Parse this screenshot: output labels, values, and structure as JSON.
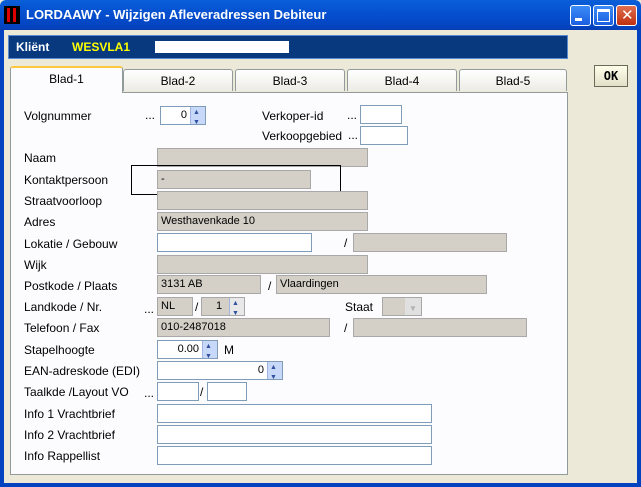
{
  "window": {
    "title": "LORDAAWY - Wijzigen Afleveradressen Debiteur"
  },
  "client": {
    "label": "Kliënt",
    "code": "WESVLA1",
    "name": ""
  },
  "tabs": [
    {
      "label": "Blad-1",
      "active": true
    },
    {
      "label": "Blad-2",
      "active": false
    },
    {
      "label": "Blad-3",
      "active": false
    },
    {
      "label": "Blad-4",
      "active": false
    },
    {
      "label": "Blad-5",
      "active": false
    }
  ],
  "ok_button": "OK",
  "form": {
    "volgnummer": {
      "label": "Volgnummer",
      "dots": "...",
      "value": "0"
    },
    "verkoper_id": {
      "label": "Verkoper-id",
      "dots": "...",
      "value": ""
    },
    "verkoopgebied": {
      "label": "Verkoopgebied",
      "dots": "...",
      "value": ""
    },
    "naam": {
      "label": "Naam",
      "value": ""
    },
    "kontaktpersoon": {
      "label": "Kontaktpersoon",
      "value": "-"
    },
    "straatvoorloop": {
      "label": "Straatvoorloop",
      "value": ""
    },
    "adres": {
      "label": "Adres",
      "value": "Westhavenkade 10"
    },
    "lokatie": {
      "label": "Lokatie / Gebouw",
      "value": "",
      "value2": "",
      "sep": "/"
    },
    "wijk": {
      "label": "Wijk",
      "value": ""
    },
    "postkode": {
      "label": "Postkode / Plaats",
      "postcode": "3131 AB",
      "plaats": "Vlaardingen",
      "sep": "/"
    },
    "landkode": {
      "label": "Landkode  / Nr.",
      "dots": "...",
      "land": "NL",
      "nr": "1",
      "sep": "/"
    },
    "staat": {
      "label": "Staat",
      "value": ""
    },
    "telefoon": {
      "label": "Telefoon / Fax",
      "telefoon": "010-2487018",
      "fax": "",
      "sep": "/"
    },
    "stapelhoogte": {
      "label": "Stapelhoogte",
      "value": "0.00",
      "unit": "M"
    },
    "ean": {
      "label": "EAN-adreskode (EDI)",
      "value": "0"
    },
    "taalkde": {
      "label": "Taalkde /Layout VO",
      "dots": "...",
      "value1": "",
      "value2": "",
      "sep": "/"
    },
    "info1": {
      "label": "Info 1 Vrachtbrief",
      "value": ""
    },
    "info2": {
      "label": "Info 2 Vrachtbrief",
      "value": ""
    },
    "info_rappel": {
      "label": "Info Rappellist",
      "value": ""
    }
  },
  "colors": {
    "titlebar": "#0551D0",
    "clientbar": "#08397F",
    "client_code": "#FFFF00",
    "label_text": "#000000",
    "readonly_field": "#D4D0C8"
  }
}
